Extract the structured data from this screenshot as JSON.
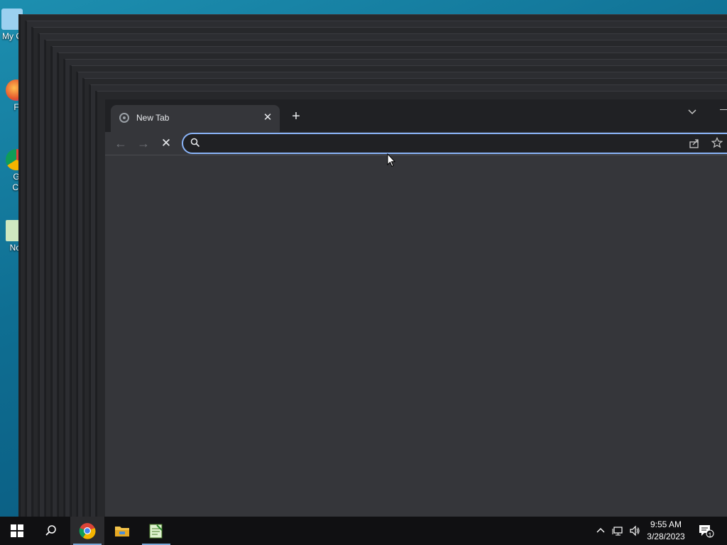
{
  "desktop": {
    "icons": [
      {
        "label": "My C",
        "icon": "computer-icon"
      },
      {
        "label": "F",
        "icon": "firefox-icon"
      },
      {
        "label": "G\nCl",
        "icon": "chrome-icon"
      },
      {
        "label": "Not",
        "icon": "notepad-icon"
      }
    ]
  },
  "browser": {
    "tab": {
      "title": "New Tab",
      "favicon": "chrome-newtab-icon"
    },
    "new_tab_label": "+",
    "nav": {
      "back": "←",
      "forward": "→",
      "stop": "✕"
    },
    "omnibox": {
      "value": "",
      "placeholder": ""
    },
    "colors": {
      "frame": "#202124",
      "toolbar": "#35363a",
      "focus_ring": "#8ab4f8"
    }
  },
  "taskbar": {
    "apps": [
      {
        "name": "start",
        "icon": "windows-start-icon"
      },
      {
        "name": "search",
        "icon": "search-icon"
      },
      {
        "name": "chrome",
        "icon": "chrome-icon",
        "active": true
      },
      {
        "name": "file-explorer",
        "icon": "folder-icon"
      },
      {
        "name": "notepad",
        "icon": "notepad-icon"
      }
    ],
    "clock": {
      "time": "9:55 AM",
      "date": "3/28/2023"
    },
    "notifications_count": "1"
  }
}
